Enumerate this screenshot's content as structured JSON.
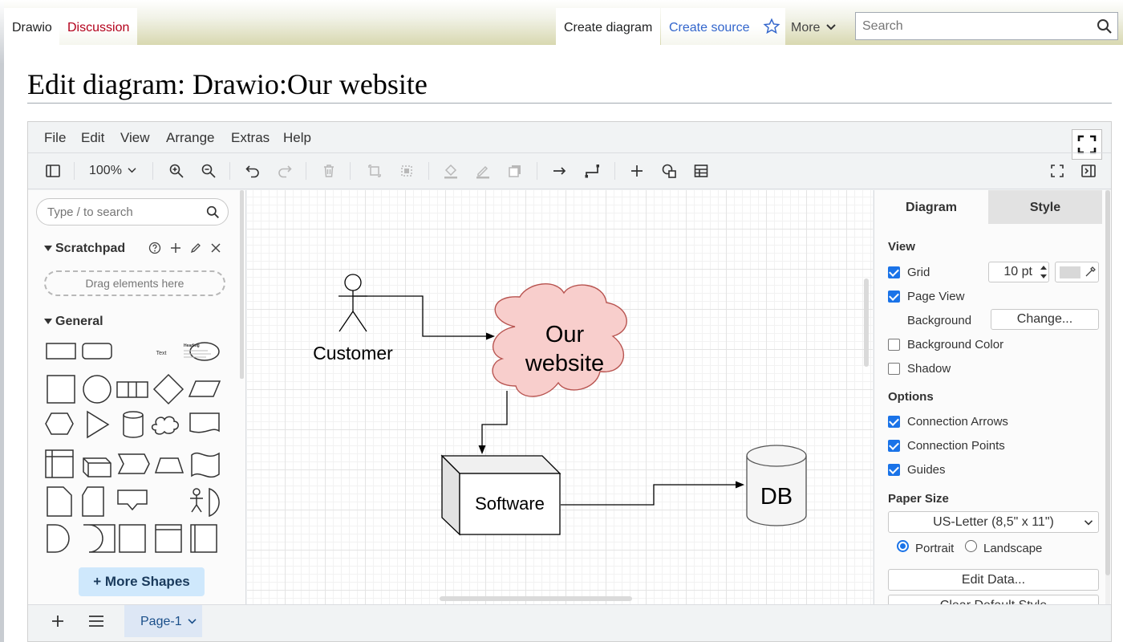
{
  "wiki": {
    "tabs_left": [
      {
        "label": "Drawio"
      },
      {
        "label": "Discussion"
      }
    ],
    "tabs_right": [
      {
        "label": "Create diagram"
      },
      {
        "label": "Create source"
      },
      {
        "label": "More"
      }
    ],
    "search_placeholder": "Search",
    "page_title": "Edit diagram: Drawio:Our website"
  },
  "drawio": {
    "menu": [
      "File",
      "Edit",
      "View",
      "Arrange",
      "Extras",
      "Help"
    ],
    "zoom": "100%",
    "shape_search_placeholder": "Type / to search",
    "scratchpad": {
      "title": "Scratchpad",
      "drop_hint": "Drag elements here"
    },
    "general": {
      "title": "General",
      "text_label": "Text",
      "heading_label": "Heading"
    },
    "more_shapes": "+ More Shapes",
    "diagram": {
      "actor_label": "Customer",
      "cloud_label_line1": "Our",
      "cloud_label_line2": "website",
      "cube_label": "Software",
      "db_label": "DB"
    },
    "format_panel": {
      "tabs": [
        "Diagram",
        "Style"
      ],
      "view_title": "View",
      "grid_label": "Grid",
      "grid_size": "10 pt",
      "page_view_label": "Page View",
      "background_label": "Background",
      "change_label": "Change...",
      "background_color_label": "Background Color",
      "shadow_label": "Shadow",
      "options_title": "Options",
      "connection_arrows_label": "Connection Arrows",
      "connection_points_label": "Connection Points",
      "guides_label": "Guides",
      "paper_size_title": "Paper Size",
      "paper_size_value": "US-Letter (8,5\" x 11\")",
      "portrait_label": "Portrait",
      "landscape_label": "Landscape",
      "edit_data_label": "Edit Data...",
      "clear_default_style_label": "Clear Default Style"
    },
    "page_tab": "Page-1"
  },
  "colors": {
    "cloud_fill": "#f8cecc",
    "cloud_stroke": "#b85450",
    "accent": "#1a73e8",
    "link": "#3366cc",
    "redlink": "#b3001b"
  }
}
